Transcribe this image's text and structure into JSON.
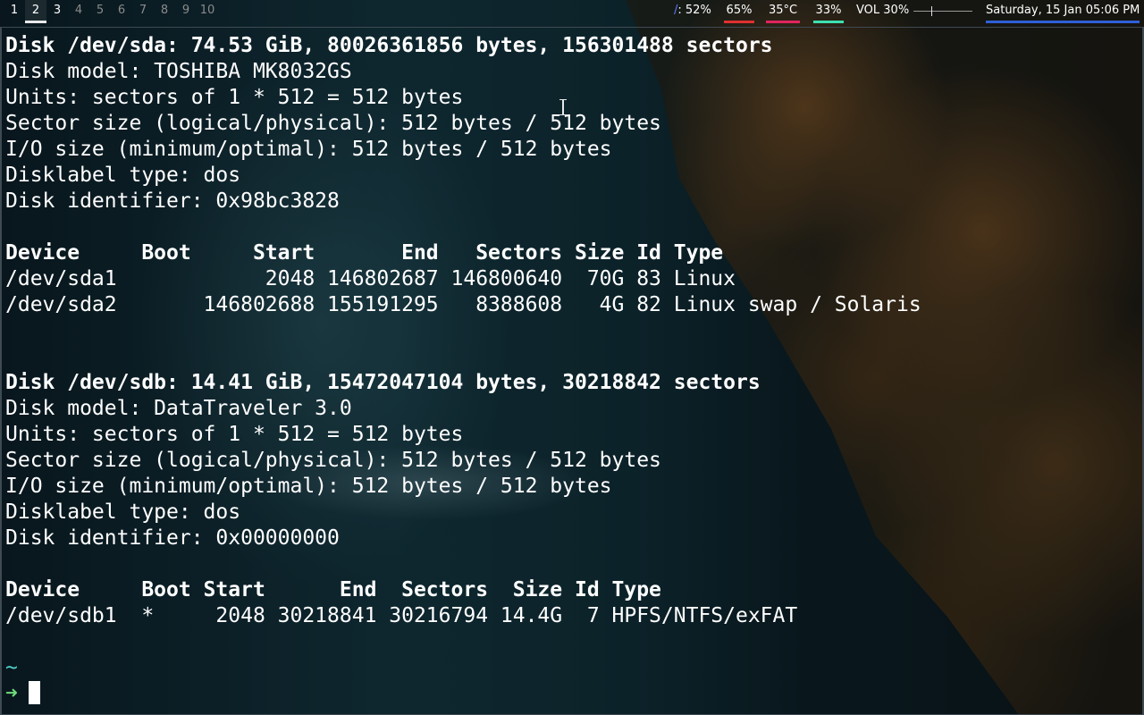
{
  "topbar": {
    "workspaces": [
      {
        "label": "1",
        "state": "used"
      },
      {
        "label": "2",
        "state": "active"
      },
      {
        "label": "3",
        "state": "used"
      },
      {
        "label": "4",
        "state": "empty"
      },
      {
        "label": "5",
        "state": "empty"
      },
      {
        "label": "6",
        "state": "empty"
      },
      {
        "label": "7",
        "state": "empty"
      },
      {
        "label": "8",
        "state": "empty"
      },
      {
        "label": "9",
        "state": "empty"
      },
      {
        "label": "10",
        "state": "empty"
      }
    ],
    "cpu": {
      "glyph": "/",
      "text": ": 52%",
      "icon": "cpu-icon",
      "color": "#5c7cff"
    },
    "memory": {
      "text": "65%",
      "color": "#e03030"
    },
    "temperature": {
      "text": "35°C",
      "color": "#e0245e"
    },
    "disk": {
      "text": "33%",
      "color": "#3ce0b0"
    },
    "volume": {
      "text": "VOL 30%",
      "level": 0.3
    },
    "clock": {
      "text": "Saturday, 15 Jan 05:06 PM",
      "color": "#2f5fd8"
    }
  },
  "terminal": {
    "lines": [
      {
        "text": "Disk /dev/sda: 74.53 GiB, 80026361856 bytes, 156301488 sectors",
        "bold": true
      },
      {
        "text": "Disk model: TOSHIBA MK8032GS"
      },
      {
        "text": "Units: sectors of 1 * 512 = 512 bytes"
      },
      {
        "text": "Sector size (logical/physical): 512 bytes / 512 bytes"
      },
      {
        "text": "I/O size (minimum/optimal): 512 bytes / 512 bytes"
      },
      {
        "text": "Disklabel type: dos"
      },
      {
        "text": "Disk identifier: 0x98bc3828"
      },
      {
        "text": ""
      },
      {
        "text": "Device     Boot     Start       End   Sectors Size Id Type",
        "bold": true
      },
      {
        "text": "/dev/sda1            2048 146802687 146800640  70G 83 Linux"
      },
      {
        "text": "/dev/sda2       146802688 155191295   8388608   4G 82 Linux swap / Solaris"
      },
      {
        "text": ""
      },
      {
        "text": ""
      },
      {
        "text": "Disk /dev/sdb: 14.41 GiB, 15472047104 bytes, 30218842 sectors",
        "bold": true
      },
      {
        "text": "Disk model: DataTraveler 3.0"
      },
      {
        "text": "Units: sectors of 1 * 512 = 512 bytes"
      },
      {
        "text": "Sector size (logical/physical): 512 bytes / 512 bytes"
      },
      {
        "text": "I/O size (minimum/optimal): 512 bytes / 512 bytes"
      },
      {
        "text": "Disklabel type: dos"
      },
      {
        "text": "Disk identifier: 0x00000000"
      },
      {
        "text": ""
      },
      {
        "text": "Device     Boot Start      End  Sectors  Size Id Type",
        "bold": true
      },
      {
        "text": "/dev/sdb1  *     2048 30218841 30216794 14.4G  7 HPFS/NTFS/exFAT"
      },
      {
        "text": ""
      }
    ],
    "prompt": {
      "cwd": "~",
      "arrow": "➜",
      "input": ""
    }
  }
}
